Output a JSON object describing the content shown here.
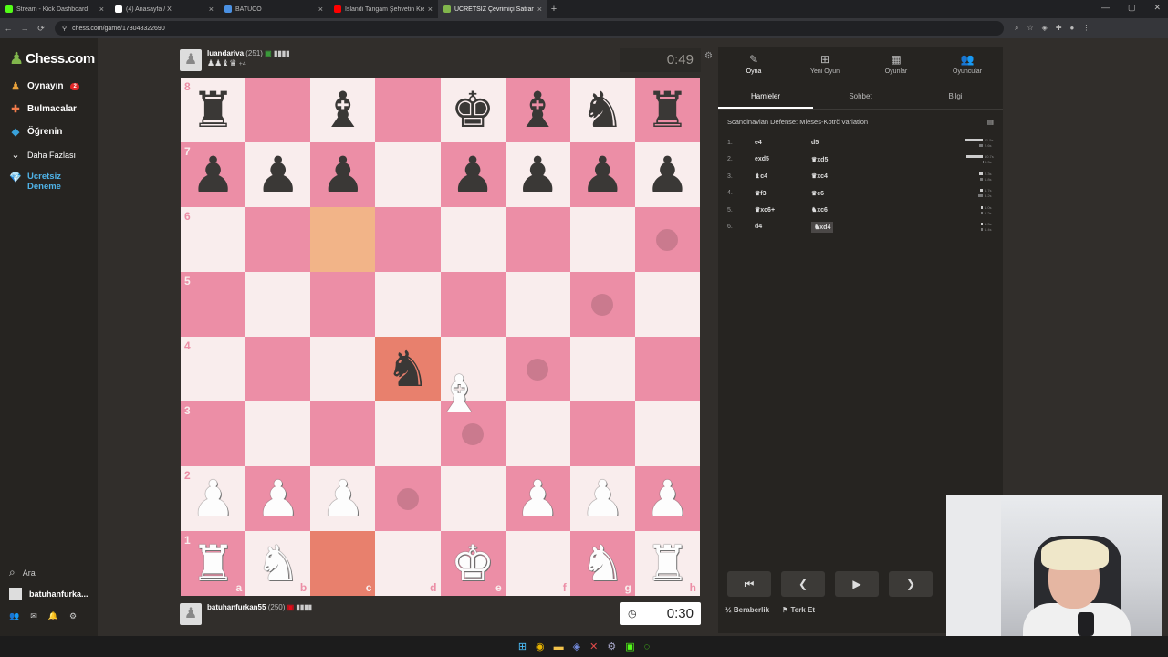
{
  "browser": {
    "tabs": [
      {
        "title": "Stream - Kick Dashboard",
        "color": "#53fc18"
      },
      {
        "title": "(4) Anasayfa / X",
        "color": "#ffffff"
      },
      {
        "title": "BATUCO",
        "color": "#4a90e2"
      },
      {
        "title": "İslandi Tangam Şehvetin Kremi",
        "color": "#ff0000"
      },
      {
        "title": "ÜCRETSİZ Çevrimiçi Satranç",
        "color": "#81b64c"
      }
    ],
    "url": "chess.com/game/173048322690"
  },
  "sidebar": {
    "logo": "Chess.com",
    "items": [
      {
        "label": "Oynayın",
        "badge": "2",
        "icon": "play-icon"
      },
      {
        "label": "Bulmacalar",
        "icon": "puzzle-icon"
      },
      {
        "label": "Öğrenin",
        "icon": "learn-icon"
      },
      {
        "label": "Daha Fazlası",
        "icon": "chevron-down-icon"
      },
      {
        "label": "Ücretsiz Deneme",
        "icon": "diamond-icon"
      }
    ],
    "search": "Ara",
    "user": "batuhanfurka...",
    "badges": {
      "friends": "42",
      "messages": "21",
      "notifications": "2"
    }
  },
  "top_player": {
    "name": "luandariva",
    "rating": "(251)",
    "captured": "♟♟♝♛",
    "advantage": "+4",
    "clock": "0:49"
  },
  "bottom_player": {
    "name": "batuhanfurkan55",
    "rating": "(250)",
    "clock": "0:30"
  },
  "board": {
    "rows": [
      [
        "br",
        "",
        "bb",
        "",
        "bk",
        "bb",
        "bn",
        "br"
      ],
      [
        "bp",
        "bp",
        "bp",
        "",
        "bp",
        "bp",
        "bp",
        "bp"
      ],
      [
        "",
        "",
        "",
        "",
        "",
        "",
        "",
        ""
      ],
      [
        "",
        "",
        "",
        "",
        "",
        "",
        "",
        ""
      ],
      [
        "",
        "",
        "",
        "bn",
        "",
        "",
        "",
        ""
      ],
      [
        "",
        "",
        "",
        "",
        "",
        "",
        "",
        ""
      ],
      [
        "wp",
        "wp",
        "wp",
        "",
        "",
        "wp",
        "wp",
        "wp"
      ],
      [
        "wr",
        "wn",
        "",
        "",
        "wk",
        "",
        "wn",
        "wr"
      ]
    ],
    "ranks": [
      "8",
      "7",
      "6",
      "5",
      "4",
      "3",
      "2",
      "1"
    ],
    "files": [
      "a",
      "b",
      "c",
      "d",
      "e",
      "f",
      "g",
      "h"
    ],
    "highlight": [
      "c6",
      "d4",
      "c1"
    ],
    "dots": [
      "h6",
      "g5",
      "f4",
      "e3",
      "d2"
    ],
    "dragging": "wb"
  },
  "panel": {
    "tabs": [
      {
        "label": "Oyna",
        "icon": "play-icon"
      },
      {
        "label": "Yeni Oyun",
        "icon": "plus-icon"
      },
      {
        "label": "Oyunlar",
        "icon": "board-icon"
      },
      {
        "label": "Oyuncular",
        "icon": "users-icon"
      }
    ],
    "subtabs": [
      "Hamleler",
      "Sohbet",
      "Bilgi"
    ],
    "opening": "Scandinavian Defense: Mieses-Kotrč Variation",
    "moves": [
      {
        "no": "1.",
        "white": "e4",
        "black": "d5",
        "tw": "11.5s",
        "tb": "2.6s"
      },
      {
        "no": "2.",
        "white": "exd5",
        "black": "♛xd5",
        "tw": "10.7s",
        "tb": "0.3s"
      },
      {
        "no": "3.",
        "white": "♝c4",
        "black": "♛xc4",
        "tw": "2.3s",
        "tb": "1.8s"
      },
      {
        "no": "4.",
        "white": "♛f3",
        "black": "♛c6",
        "tw": "1.7s",
        "tb": "3.2s"
      },
      {
        "no": "5.",
        "white": "♛xc6+",
        "black": "♞xc6",
        "tw": "1.0s",
        "tb": "1.2s"
      },
      {
        "no": "6.",
        "white": "d4",
        "black": "♞xd4",
        "tw": "1.3s",
        "tb": "1.4s"
      }
    ],
    "draw": "Beraberlik",
    "draw_prefix": "½",
    "resign": "Terk Et"
  }
}
